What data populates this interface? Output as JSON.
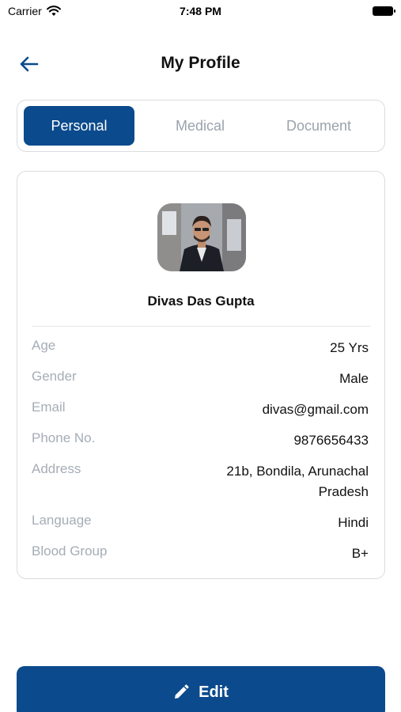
{
  "status_bar": {
    "carrier": "Carrier",
    "time": "7:48 PM"
  },
  "header": {
    "title": "My Profile",
    "back_icon": "arrow-left-icon"
  },
  "tabs": [
    {
      "label": "Personal",
      "active": true
    },
    {
      "label": "Medical",
      "active": false
    },
    {
      "label": "Document",
      "active": false
    }
  ],
  "profile": {
    "name": "Divas Das Gupta",
    "fields": [
      {
        "label": "Age",
        "value": "25 Yrs"
      },
      {
        "label": "Gender",
        "value": "Male"
      },
      {
        "label": "Email",
        "value": "divas@gmail.com"
      },
      {
        "label": "Phone No.",
        "value": "9876656433"
      },
      {
        "label": "Address",
        "value": "21b, Bondila, Arunachal Pradesh"
      },
      {
        "label": "Language",
        "value": "Hindi"
      },
      {
        "label": "Blood Group",
        "value": "B+"
      }
    ]
  },
  "edit_button": {
    "label": "Edit",
    "icon": "pencil-icon"
  },
  "colors": {
    "primary": "#0b4a8c",
    "muted_text": "#a5adb6",
    "border": "#d9dce1"
  }
}
